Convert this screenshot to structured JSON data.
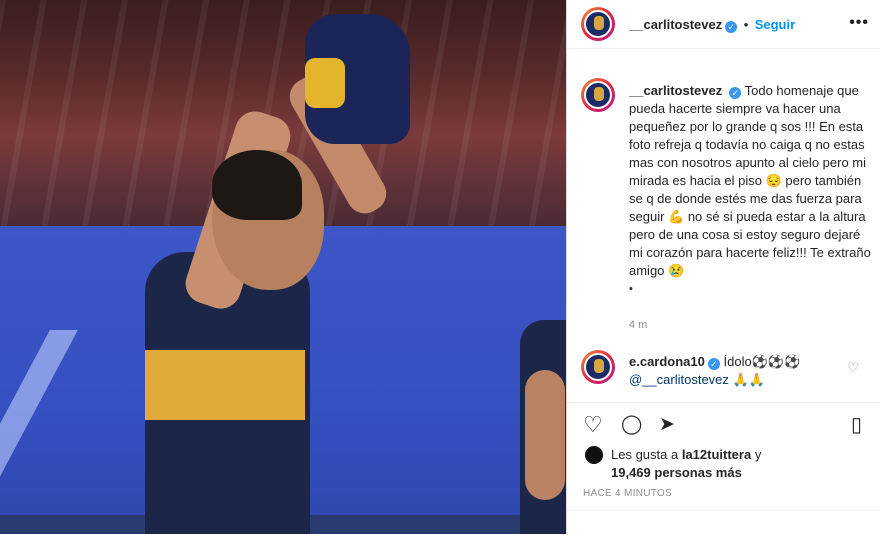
{
  "post": {
    "author": "__carlitostevez",
    "follow_label": "Seguir",
    "more_label": "•••",
    "verified_glyph": "✓",
    "caption": "Todo homenaje que pueda hacerte siempre va hacer una pequeñez por lo grande q sos !!! En esta foto refreja q todavía no caiga q no estas mas con nosotros apunto al cielo pero mi mirada es hacia el piso 😔 pero también se q de donde estés me das fuerza para seguir 💪 no sé si pueda estar a la altura pero de una cosa si estoy seguro dejaré mi corazón para hacerte feliz!!! Te extraño amigo 😢",
    "caption_dot": "•",
    "time": "4 m"
  },
  "comment": {
    "author": "e.cardona10",
    "text": "Ídolo⚽⚽⚽",
    "mention": "@__carlitostevez",
    "emoji": "🙏🙏",
    "like_icon": "♡"
  },
  "actions": {
    "like_icon": "♡",
    "comment_icon": "◯",
    "share_icon": "➤",
    "save_icon": "▯"
  },
  "likes": {
    "prefix": "Les gusta a",
    "user": "la12tuittera",
    "mid": "y",
    "count": "19,469 personas más"
  },
  "posted_ago": "HACE 4 MINUTOS",
  "colors": {
    "accent": "#0095f6",
    "verified": "#3897f0",
    "text": "#262626",
    "muted": "#8e8e8e"
  }
}
